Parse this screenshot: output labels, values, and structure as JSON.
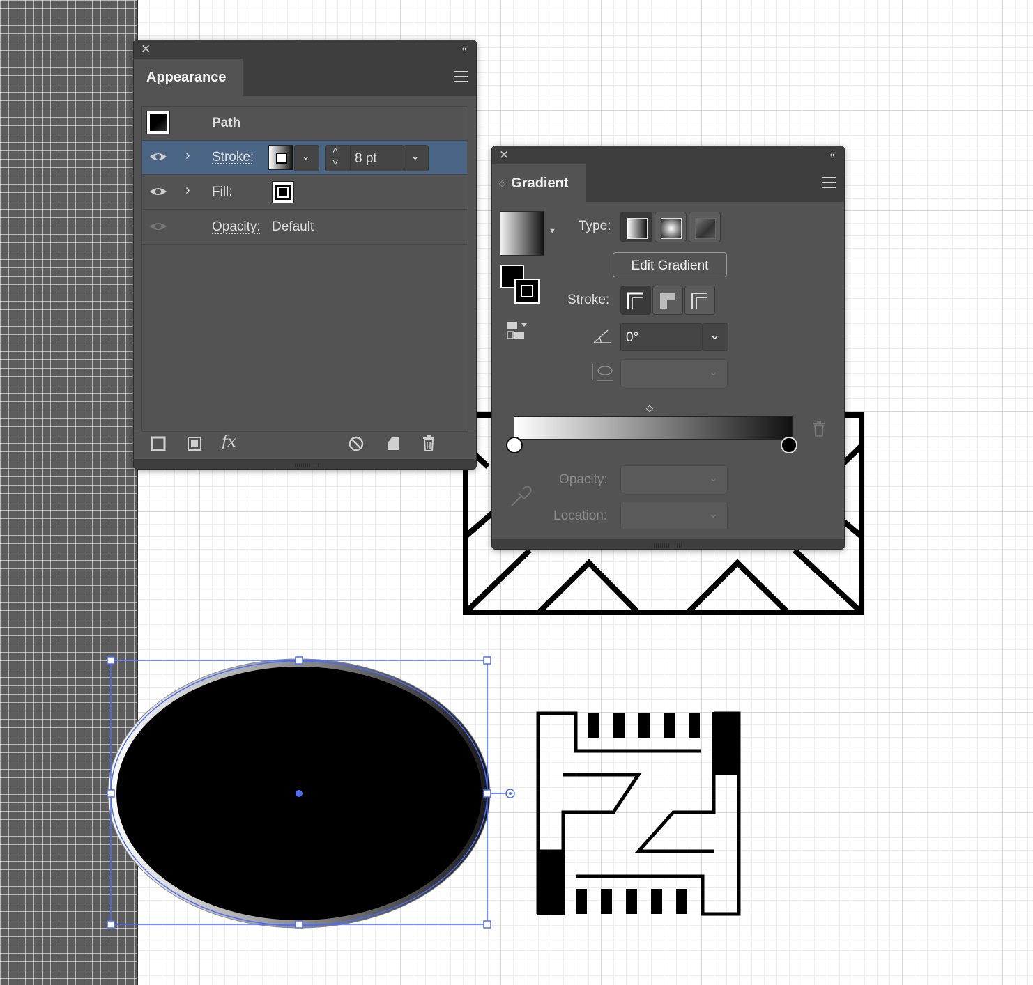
{
  "appearance": {
    "title": "Appearance",
    "object_type": "Path",
    "stroke_label": "Stroke:",
    "stroke_weight": "8 pt",
    "fill_label": "Fill:",
    "opacity_label": "Opacity:",
    "opacity_value": "Default"
  },
  "gradient": {
    "title": "Gradient",
    "type_label": "Type:",
    "edit_button": "Edit Gradient",
    "stroke_label": "Stroke:",
    "angle_value": "0°",
    "opacity_label": "Opacity:",
    "location_label": "Location:",
    "stops": [
      {
        "color": "#ffffff",
        "location": 0
      },
      {
        "color": "#000000",
        "location": 100
      }
    ],
    "midpoint": 50
  },
  "colors": {
    "panel_bg": "#535353",
    "selection_row": "#4b6584",
    "selection_blue": "#4a6cf7"
  }
}
